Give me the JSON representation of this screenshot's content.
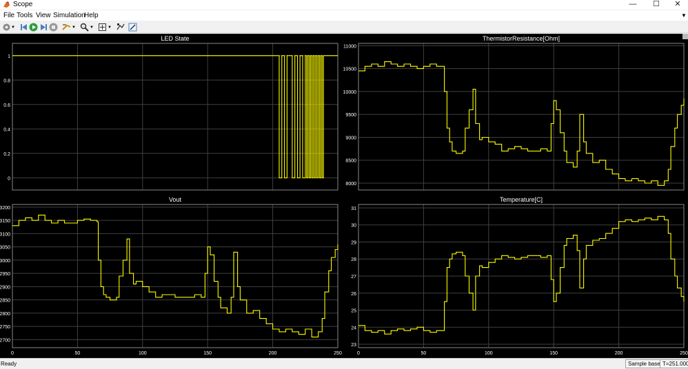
{
  "window": {
    "title": "Scope",
    "minimize_glyph": "—",
    "maximize_glyph": "☐",
    "close_glyph": "✕"
  },
  "menu": [
    "File",
    "Tools",
    "View",
    "Simulation",
    "Help"
  ],
  "toolbar_icons": [
    "settings-icon",
    "step-back-icon",
    "run-icon",
    "step-forward-icon",
    "stop-icon",
    "highlight-icon",
    "zoom-icon",
    "fit-axes-icon",
    "cursor-measurement-icon",
    "style-icon"
  ],
  "colors": {
    "trace": "#ffff00",
    "background": "#000000",
    "grid": "#404040",
    "text": "#ffffff",
    "axes_border": "#ffffff"
  },
  "status": {
    "left": "Ready",
    "sample_mode": "Sample based",
    "time": "T=251.000"
  },
  "chart_data": [
    {
      "type": "line",
      "title": "LED State",
      "xlim": [
        0,
        250
      ],
      "ylim": [
        -0.1,
        1.1
      ],
      "yticks": [
        0,
        0.2,
        0.4,
        0.6,
        0.8,
        1
      ],
      "ytick_labels": [
        "0",
        "0.2",
        "0.4",
        "0.6",
        "0.8",
        "1"
      ],
      "xticks": [
        0,
        50,
        100,
        150,
        200,
        250
      ],
      "xtick_labels": [],
      "grid": true,
      "x": [
        0,
        205,
        205,
        207,
        207,
        209,
        209,
        211,
        211,
        213,
        213,
        215,
        215,
        217,
        217,
        219,
        219,
        221,
        221,
        223,
        223,
        225,
        225,
        226,
        226,
        227,
        227,
        228,
        228,
        229,
        229,
        230,
        230,
        231,
        231,
        232,
        232,
        233,
        233,
        234,
        234,
        235,
        235,
        236,
        236,
        237,
        237,
        238,
        238,
        239,
        239,
        251
      ],
      "y": [
        1,
        1,
        0,
        0,
        1,
        1,
        0,
        0,
        1,
        1,
        1,
        1,
        0,
        0,
        1,
        1,
        0,
        0,
        1,
        1,
        0,
        0,
        1,
        1,
        0,
        0,
        1,
        1,
        0,
        0,
        1,
        1,
        0,
        0,
        1,
        1,
        0,
        0,
        1,
        1,
        0,
        0,
        1,
        1,
        0,
        0,
        1,
        1,
        0,
        0,
        1,
        1
      ]
    },
    {
      "type": "line",
      "title": "ThermistorResistance[Ohm]",
      "xlim": [
        0,
        250
      ],
      "ylim": [
        7850,
        11050
      ],
      "yticks": [
        8000,
        8500,
        9000,
        9500,
        10000,
        10500,
        11000
      ],
      "ytick_labels": [
        "8000",
        "8500",
        "9000",
        "9500",
        "10000",
        "10500",
        "11000"
      ],
      "xticks": [
        0,
        50,
        100,
        150,
        200,
        250
      ],
      "xtick_labels": [],
      "grid": true,
      "x": [
        0,
        5,
        10,
        15,
        20,
        25,
        30,
        35,
        40,
        45,
        50,
        55,
        60,
        65,
        66,
        68,
        70,
        72,
        75,
        80,
        82,
        85,
        88,
        90,
        93,
        95,
        100,
        105,
        110,
        115,
        120,
        125,
        130,
        140,
        145,
        148,
        150,
        152,
        155,
        158,
        160,
        165,
        168,
        170,
        173,
        175,
        180,
        185,
        190,
        195,
        200,
        205,
        210,
        215,
        220,
        225,
        230,
        235,
        238,
        240,
        243,
        245,
        248,
        251
      ],
      "y": [
        10450,
        10550,
        10600,
        10550,
        10650,
        10600,
        10550,
        10600,
        10550,
        10500,
        10550,
        10600,
        10550,
        10550,
        10000,
        9200,
        8900,
        8700,
        8650,
        8700,
        9200,
        9600,
        10050,
        9300,
        8950,
        9000,
        8900,
        8850,
        8700,
        8750,
        8800,
        8750,
        8700,
        8750,
        8700,
        9300,
        9800,
        9600,
        9100,
        8700,
        8450,
        8350,
        8700,
        9500,
        8900,
        8650,
        8450,
        8500,
        8300,
        8200,
        8100,
        8050,
        8100,
        8050,
        8000,
        8050,
        7950,
        8050,
        8300,
        8800,
        9200,
        9500,
        9700,
        9850
      ]
    },
    {
      "type": "line",
      "title": "Vout",
      "xlim": [
        0,
        250
      ],
      "ylim": [
        2670,
        3210
      ],
      "yticks": [
        2700,
        2750,
        2800,
        2850,
        2900,
        2950,
        3000,
        3050,
        3100,
        3150,
        3200
      ],
      "ytick_labels": [
        "2700",
        "2750",
        "2800",
        "2850",
        "2900",
        "2950",
        "3000",
        "3050",
        "3100",
        "3150",
        "3200"
      ],
      "xticks": [
        0,
        50,
        100,
        150,
        200,
        250
      ],
      "xtick_labels": [
        "0",
        "50",
        "100",
        "150",
        "200",
        "250"
      ],
      "grid": true,
      "x": [
        0,
        5,
        10,
        15,
        20,
        25,
        30,
        35,
        40,
        45,
        50,
        55,
        60,
        65,
        66,
        68,
        70,
        72,
        75,
        80,
        82,
        85,
        88,
        90,
        93,
        95,
        100,
        105,
        110,
        115,
        120,
        125,
        130,
        140,
        145,
        148,
        150,
        152,
        155,
        158,
        160,
        165,
        168,
        170,
        173,
        175,
        180,
        185,
        190,
        195,
        200,
        205,
        210,
        215,
        220,
        225,
        230,
        235,
        238,
        240,
        243,
        245,
        248,
        251
      ],
      "y": [
        3130,
        3150,
        3160,
        3150,
        3170,
        3150,
        3140,
        3150,
        3140,
        3140,
        3150,
        3155,
        3150,
        3145,
        3000,
        2900,
        2870,
        2860,
        2850,
        2860,
        2940,
        3000,
        3080,
        2950,
        2910,
        2920,
        2900,
        2880,
        2860,
        2870,
        2870,
        2860,
        2860,
        2870,
        2860,
        2950,
        3050,
        3020,
        2920,
        2860,
        2820,
        2800,
        2860,
        3030,
        2900,
        2850,
        2800,
        2810,
        2780,
        2760,
        2740,
        2730,
        2740,
        2730,
        2720,
        2740,
        2710,
        2730,
        2780,
        2880,
        2960,
        3010,
        3040,
        3060
      ]
    },
    {
      "type": "line",
      "title": "Temperature[C]",
      "xlim": [
        0,
        250
      ],
      "ylim": [
        22.8,
        31.2
      ],
      "yticks": [
        23,
        24,
        25,
        26,
        27,
        28,
        29,
        30,
        31
      ],
      "ytick_labels": [
        "23",
        "24",
        "25",
        "26",
        "27",
        "28",
        "29",
        "30",
        "31"
      ],
      "xticks": [
        0,
        50,
        100,
        150,
        200,
        250
      ],
      "xtick_labels": [
        "0",
        "50",
        "100",
        "150",
        "200",
        "250"
      ],
      "grid": true,
      "x": [
        0,
        5,
        10,
        15,
        20,
        25,
        30,
        35,
        40,
        45,
        50,
        55,
        60,
        65,
        66,
        68,
        70,
        72,
        75,
        80,
        82,
        85,
        88,
        90,
        93,
        95,
        100,
        105,
        110,
        115,
        120,
        125,
        130,
        140,
        145,
        148,
        150,
        152,
        155,
        158,
        160,
        165,
        168,
        170,
        173,
        175,
        180,
        185,
        190,
        195,
        200,
        205,
        210,
        215,
        220,
        225,
        230,
        235,
        238,
        240,
        243,
        245,
        248,
        251
      ],
      "y": [
        24.1,
        23.8,
        23.7,
        23.8,
        23.6,
        23.8,
        23.9,
        23.8,
        23.9,
        24.0,
        23.8,
        23.7,
        23.8,
        23.8,
        25.5,
        27.5,
        28.0,
        28.3,
        28.4,
        28.2,
        27.0,
        26.0,
        25.0,
        27.0,
        27.6,
        27.5,
        27.8,
        28.0,
        28.2,
        28.1,
        28.0,
        28.1,
        28.2,
        28.1,
        28.2,
        26.8,
        25.5,
        26.0,
        27.5,
        28.8,
        29.2,
        29.4,
        28.5,
        26.3,
        28.0,
        28.8,
        29.1,
        29.2,
        29.5,
        29.8,
        30.2,
        30.3,
        30.2,
        30.3,
        30.4,
        30.3,
        30.5,
        30.3,
        29.5,
        28.0,
        27.0,
        26.3,
        25.8,
        25.5
      ]
    }
  ]
}
